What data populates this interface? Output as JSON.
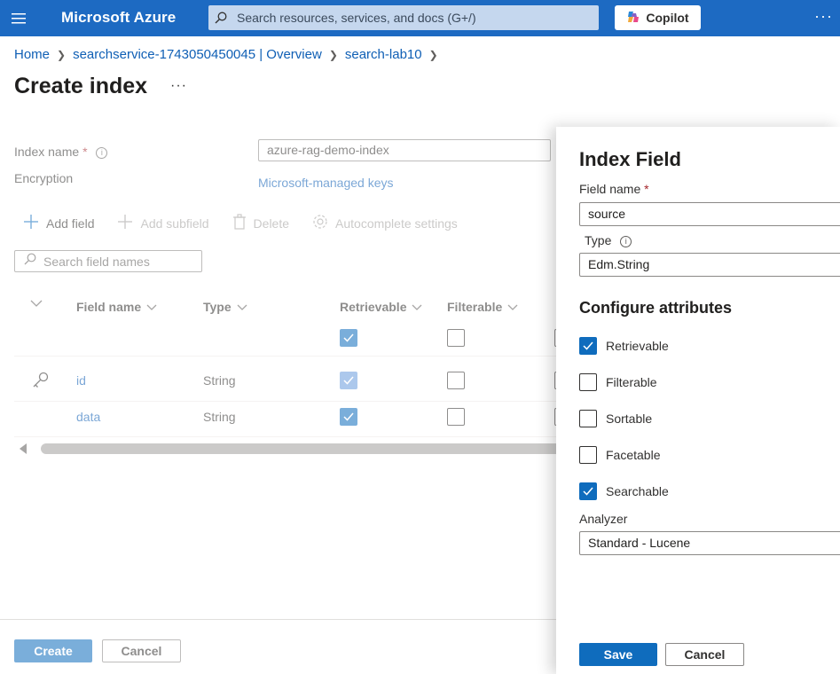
{
  "topbar": {
    "brand": "Microsoft Azure",
    "search_placeholder": "Search resources, services, and docs (G+/)",
    "copilot_label": "Copilot",
    "more": "···",
    "colors": {
      "bar": "#1d6ac2"
    }
  },
  "breadcrumb": [
    "Home",
    "searchservice-1743050450045 | Overview",
    "search-lab10"
  ],
  "page": {
    "title": "Create index",
    "more": "···"
  },
  "form": {
    "index_name_label": "Index name",
    "required_mark": "*",
    "index_name_value": "azure-rag-demo-index",
    "encryption_label": "Encryption",
    "encryption_value": "Microsoft-managed keys"
  },
  "toolbar": {
    "add_field": "Add field",
    "add_subfield": "Add subfield",
    "delete": "Delete",
    "autocomplete": "Autocomplete settings"
  },
  "field_search_placeholder": "Search field names",
  "grid": {
    "columns": [
      "Field name",
      "Type",
      "Retrievable",
      "Filterable"
    ],
    "rows": [
      {
        "name": "id",
        "type": "String",
        "retrievable": true,
        "filterable": false,
        "key": true
      },
      {
        "name": "data",
        "type": "String",
        "retrievable": true,
        "filterable": false,
        "key": false
      }
    ]
  },
  "footer": {
    "create": "Create",
    "cancel": "Cancel"
  },
  "panel": {
    "title": "Index Field",
    "field_name_label": "Field name",
    "required_mark": "*",
    "field_name_value": "source",
    "type_label": "Type",
    "type_value": "Edm.String",
    "section": "Configure attributes",
    "attributes": [
      {
        "label": "Retrievable",
        "checked": true
      },
      {
        "label": "Filterable",
        "checked": false
      },
      {
        "label": "Sortable",
        "checked": false
      },
      {
        "label": "Facetable",
        "checked": false
      },
      {
        "label": "Searchable",
        "checked": true
      }
    ],
    "analyzer_label": "Analyzer",
    "analyzer_value": "Standard - Lucene",
    "save": "Save",
    "cancel": "Cancel"
  }
}
